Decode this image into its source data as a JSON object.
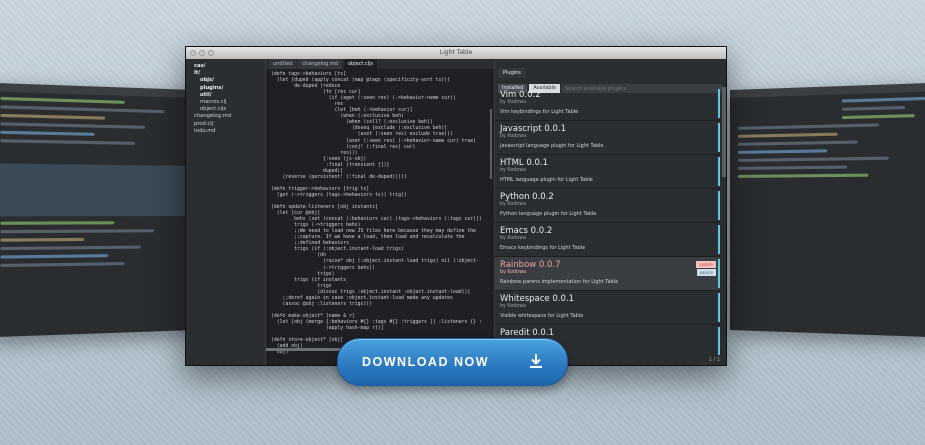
{
  "window": {
    "title": "Light Table"
  },
  "sidebar": {
    "items": [
      {
        "label": "cas/",
        "bold": true,
        "indent": 0
      },
      {
        "label": "lt/",
        "bold": true,
        "indent": 0
      },
      {
        "label": "objs/",
        "bold": true,
        "indent": 1
      },
      {
        "label": "plugins/",
        "bold": true,
        "indent": 1
      },
      {
        "label": "util/",
        "bold": true,
        "indent": 1
      },
      {
        "label": "macros.clj",
        "bold": false,
        "indent": 1
      },
      {
        "label": "object.cljs",
        "bold": false,
        "indent": 1
      },
      {
        "label": "changelog.md",
        "bold": false,
        "indent": 0
      },
      {
        "label": "prod.clj",
        "bold": false,
        "indent": 0
      },
      {
        "label": "todo.md",
        "bold": false,
        "indent": 0
      }
    ]
  },
  "editor": {
    "tabs": [
      "untitled",
      "changelog.md",
      "object.cljs"
    ],
    "active_tab": 2,
    "code": "(defn tags->behaviors [ts]\n  (let [duped (apply concat (map @tags (specificity-sort ts)))\n        de-duped (reduce\n                  (fn [res cur]\n                    (if (aget (:seen res) (->behavior-name cur))\n                      res\n                      (let [beh (->behavior cur)]\n                        (when (:exclusive beh)\n                          (when (coll? (:exclusive beh))\n                            (doseq [exclude (:exclusive beh)]\n                              (aset (:seen res) exclude true)))\n                          (aset (:seen res) (->behavior-name cur) true)\n                          (conj! (:final res) cur)\n                        res)))\n                  {:seen (js-obj)\n                   :final (transient [])}\n                  duped)]\n    (reverse (persistent! (:final de-duped)))))\n\n(defn trigger->behaviors [trig ts]\n  (get (->triggers (tags->behaviors ts)) trig))\n\n(defn update-listeners [obj instants]\n  (let [cur @obj]\n        behs (set (concat (:behaviors cur) (tags->behaviors (:tags cur)))\n        trigs (->triggers behs)\n        ;;We need to load new JS files here because they may define the\n        ;;capture. If we have a load, then load and recalculate the\n        ;;defined behaviors\n        trigs (if (:object.instant-load trigs)\n                (do\n                  (raise* obj (:object.instant-load trigs) nil (:object-\n                  (->triggers behs))\n                trigs)\n        trigs (if instants\n                trigs\n                (dissoc trigs :object.instant :object.instant-load))]\n    ;;deref again in case :object.instant-load made any updates\n    (assoc @obj :listeners trigs)))\n\n(defn make-object* [name & r]\n  (let [obj (merge {:behaviors #{} :tags #{} :triggers [] :listeners {} :\n                   (apply hash-map r))]\n\n(defn store-object* [obj]\n  (add obj)\n  obj)"
  },
  "plugins": {
    "panel_tab": "Plugins",
    "tab_installed": "Installed",
    "tab_available": "Available",
    "search_placeholder": "Search available plugins",
    "items": [
      {
        "name": "Vim",
        "version": "0.0.2",
        "author": "by Kodowa",
        "desc": "Vim keybindings for Light Table"
      },
      {
        "name": "Javascript",
        "version": "0.0.1",
        "author": "by Kodowa",
        "desc": "Javascript language plugin for Light Table"
      },
      {
        "name": "HTML",
        "version": "0.0.1",
        "author": "by Kodowa",
        "desc": "HTML language plugin for Light Table"
      },
      {
        "name": "Python",
        "version": "0.0.2",
        "author": "by Kodowa",
        "desc": "Python language plugin for Light Table"
      },
      {
        "name": "Emacs",
        "version": "0.0.2",
        "author": "by Kodowa",
        "desc": "Emacs keybindings for Light Table"
      },
      {
        "name": "Rainbow",
        "version": "0.0.7",
        "author": "by Kodowa",
        "desc": "Rainbow parens implementation for Light Table",
        "selected": true,
        "badge_update": "update",
        "badge_source": "source"
      },
      {
        "name": "Whitespace",
        "version": "0.0.1",
        "author": "by Kodowa",
        "desc": "Visible whitespace for Light Table"
      },
      {
        "name": "Paredit",
        "version": "0.0.1",
        "author": "",
        "desc": ""
      }
    ],
    "pager": "1 / 1"
  },
  "cta": {
    "download_label": "DOWNLOAD NOW"
  },
  "colors": {
    "accent": "#2f7ec4",
    "plugin_bar": "#5fc7e0",
    "selected_name": "#f0a0a0"
  }
}
